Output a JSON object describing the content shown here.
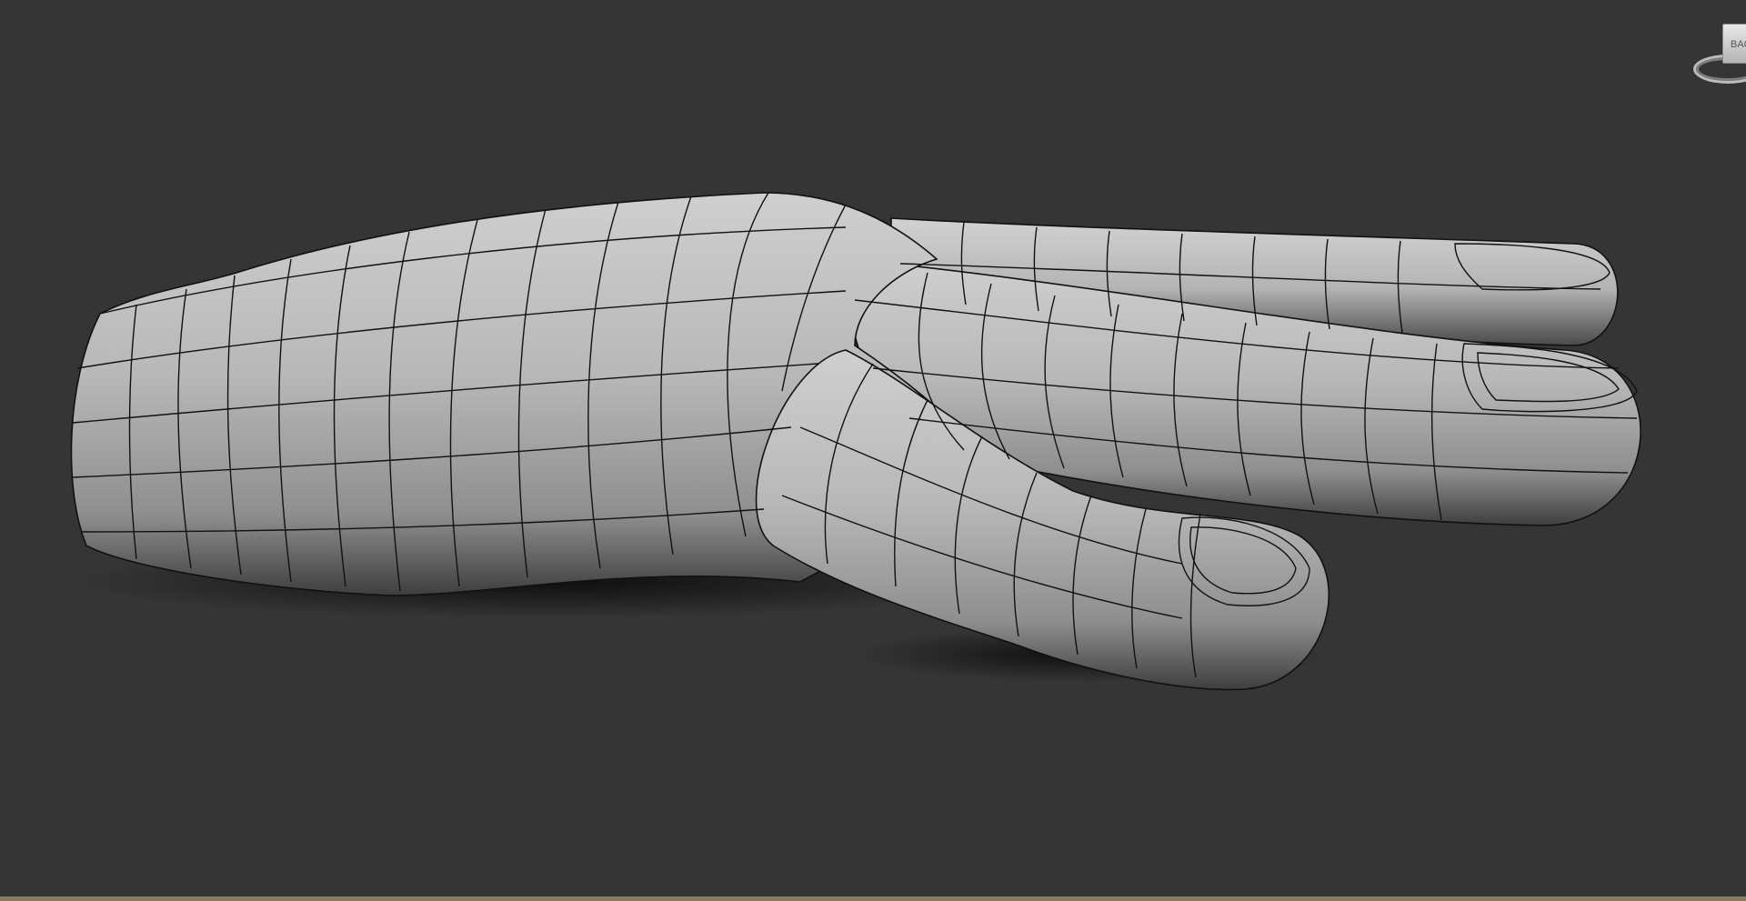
{
  "viewport": {
    "background": "#353535",
    "mesh_fill": "#b5b5b5",
    "wire_color": "#111111"
  },
  "viewcube": {
    "face_label": "BACK"
  },
  "frame": {
    "border_color": "#8a7a55"
  }
}
